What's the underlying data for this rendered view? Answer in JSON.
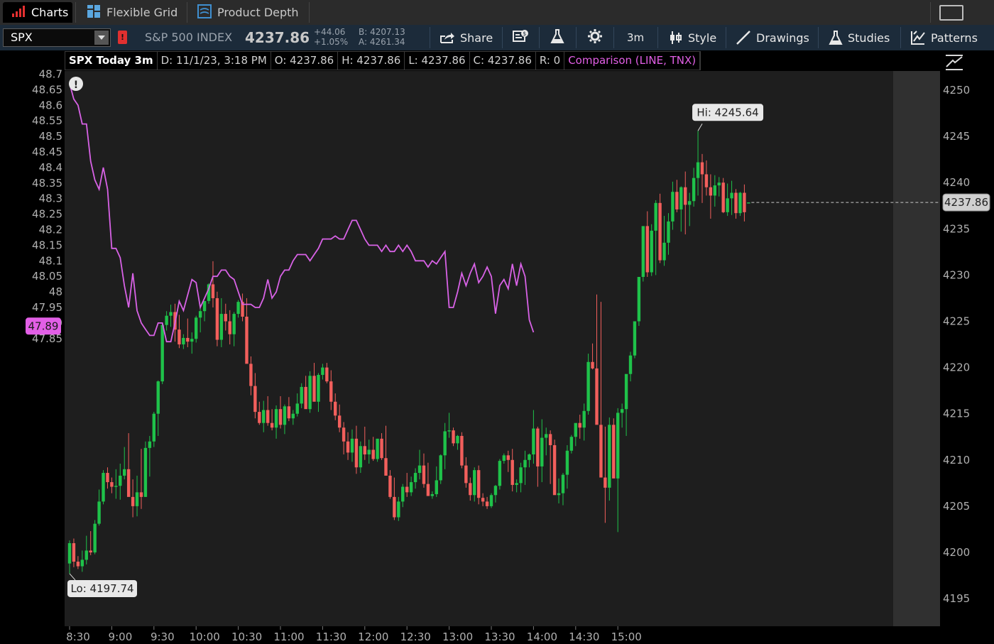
{
  "tabs": [
    {
      "label": "Charts",
      "icon": "bar-chart-icon",
      "active": true
    },
    {
      "label": "Flexible Grid",
      "icon": "grid-icon",
      "active": false
    },
    {
      "label": "Product Depth",
      "icon": "depth-icon",
      "active": false
    }
  ],
  "toolbar": {
    "symbol": "SPX",
    "alert_flag": "!",
    "index_name": "S&P 500 INDEX",
    "last_price": "4237.86",
    "net_change": "+44.06",
    "pct_change": "+1.05%",
    "bid": "B: 4207.13",
    "ask": "A: 4261.34",
    "share_label": "Share",
    "timeframe_label": "3m",
    "style_label": "Style",
    "drawings_label": "Drawings",
    "studies_label": "Studies",
    "patterns_label": "Patterns"
  },
  "infobar": {
    "title": "SPX Today 3m",
    "date": "D: 11/1/23, 3:18 PM",
    "open": "O: 4237.86",
    "high": "H: 4237.86",
    "low": "L: 4237.86",
    "close": "C: 4237.86",
    "range": "R: 0",
    "comparison": "Comparison (LINE, TNX)"
  },
  "colors": {
    "up": "#1fc24a",
    "down": "#f25f5c",
    "comparison": "#d862e6",
    "background": "#1e1e1e",
    "axis_text": "#b0b0b0"
  },
  "chart_data": {
    "type": "candlestick",
    "symbol": "SPX",
    "interval": "3m",
    "ylim_right": [
      4193,
      4253
    ],
    "ylim_left": [
      47.835,
      48.695
    ],
    "right_ticks": [
      "4250",
      "4245",
      "4240",
      "4235",
      "4230",
      "4225",
      "4220",
      "4215",
      "4210",
      "4205",
      "4200",
      "4195"
    ],
    "left_ticks": [
      "48.7",
      "48.65",
      "48.6",
      "48.55",
      "48.5",
      "48.45",
      "48.4",
      "48.35",
      "48.3",
      "48.25",
      "48.2",
      "48.15",
      "48.1",
      "48.05",
      "48",
      "47.95",
      "47.9",
      "47.85"
    ],
    "x_ticks": [
      "8:30",
      "9:00",
      "9:30",
      "10:00",
      "10:30",
      "11:00",
      "11:30",
      "12:00",
      "12:30",
      "13:00",
      "13:30",
      "14:00",
      "14:30",
      "15:00"
    ],
    "hi_label": "Hi: 4245.64",
    "lo_label": "Lo: 4197.74",
    "last_price_label": "4237.86",
    "comparison_last_label": "47.89",
    "candles": [
      [
        4198.8,
        4201.3,
        4197.7,
        4201.0
      ],
      [
        4201.0,
        4201.5,
        4198.4,
        4199.0
      ],
      [
        4199.0,
        4199.6,
        4198.2,
        4198.5
      ],
      [
        4198.5,
        4200.2,
        4197.9,
        4199.2
      ],
      [
        4199.2,
        4201.8,
        4198.7,
        4200.2
      ],
      [
        4200.2,
        4202.3,
        4199.7,
        4200.0
      ],
      [
        4200.0,
        4203.5,
        4199.8,
        4203.1
      ],
      [
        4203.1,
        4206.8,
        4202.9,
        4205.5
      ],
      [
        4205.5,
        4208.9,
        4205.2,
        4208.6
      ],
      [
        4208.6,
        4209.2,
        4206.9,
        4207.6
      ],
      [
        4207.6,
        4208.1,
        4206.4,
        4207.1
      ],
      [
        4207.1,
        4209.0,
        4205.8,
        4207.2
      ],
      [
        4207.2,
        4209.6,
        4205.7,
        4208.3
      ],
      [
        4208.3,
        4211.4,
        4207.9,
        4209.0
      ],
      [
        4209.0,
        4212.9,
        4208.4,
        4206.0
      ],
      [
        4206.0,
        4207.9,
        4203.8,
        4205.0
      ],
      [
        4205.0,
        4208.3,
        4203.9,
        4206.5
      ],
      [
        4206.5,
        4211.2,
        4204.7,
        4206.0
      ],
      [
        4206.0,
        4212.0,
        4206.0,
        4211.3
      ],
      [
        4211.3,
        4212.6,
        4208.2,
        4212.0
      ],
      [
        4212.0,
        4215.2,
        4211.4,
        4215.0
      ],
      [
        4215.0,
        4218.6,
        4212.6,
        4218.5
      ],
      [
        4218.5,
        4224.8,
        4218.2,
        4224.6
      ],
      [
        4224.6,
        4226.1,
        4224.0,
        4225.6
      ],
      [
        4225.6,
        4226.8,
        4224.4,
        4226.0
      ],
      [
        4226.0,
        4226.9,
        4222.8,
        4224.1
      ],
      [
        4224.1,
        4225.7,
        4222.1,
        4222.5
      ],
      [
        4222.5,
        4223.6,
        4222.0,
        4223.2
      ],
      [
        4223.2,
        4225.3,
        4222.2,
        4222.8
      ],
      [
        4222.8,
        4223.8,
        4221.5,
        4223.1
      ],
      [
        4223.1,
        4225.6,
        4222.7,
        4225.4
      ],
      [
        4225.4,
        4226.8,
        4223.8,
        4226.1
      ],
      [
        4226.1,
        4227.1,
        4225.0,
        4227.2
      ],
      [
        4227.2,
        4229.1,
        4226.9,
        4229.0
      ],
      [
        4229.0,
        4231.5,
        4226.5,
        4227.5
      ],
      [
        4227.5,
        4228.2,
        4222.3,
        4223.0
      ],
      [
        4223.0,
        4227.5,
        4222.2,
        4225.8
      ],
      [
        4225.8,
        4226.9,
        4224.0,
        4225.0
      ],
      [
        4225.0,
        4226.2,
        4222.5,
        4223.6
      ],
      [
        4223.6,
        4226.0,
        4222.3,
        4225.8
      ],
      [
        4225.8,
        4227.3,
        4225.4,
        4227.1
      ],
      [
        4227.1,
        4228.0,
        4225.0,
        4225.5
      ],
      [
        4225.5,
        4227.5,
        4223.7,
        4220.4
      ],
      [
        4220.4,
        4221.2,
        4217.0,
        4218.0
      ],
      [
        4218.0,
        4219.4,
        4214.5,
        4215.2
      ],
      [
        4215.2,
        4216.3,
        4213.8,
        4214.0
      ],
      [
        4214.0,
        4216.4,
        4213.0,
        4215.4
      ],
      [
        4215.4,
        4216.9,
        4213.7,
        4214.0
      ],
      [
        4214.0,
        4215.5,
        4213.2,
        4213.5
      ],
      [
        4213.5,
        4215.9,
        4212.3,
        4215.5
      ],
      [
        4215.5,
        4216.9,
        4213.4,
        4213.8
      ],
      [
        4213.8,
        4216.0,
        4212.8,
        4215.8
      ],
      [
        4215.8,
        4216.8,
        4214.2,
        4214.5
      ],
      [
        4214.5,
        4215.4,
        4213.8,
        4215.0
      ],
      [
        4215.0,
        4217.2,
        4214.7,
        4216.1
      ],
      [
        4216.1,
        4218.3,
        4215.6,
        4217.9
      ],
      [
        4217.9,
        4219.1,
        4217.3,
        4215.5
      ],
      [
        4215.5,
        4219.6,
        4215.1,
        4219.1
      ],
      [
        4219.1,
        4220.5,
        4218.1,
        4216.3
      ],
      [
        4216.3,
        4219.4,
        4215.2,
        4219.2
      ],
      [
        4219.2,
        4220.4,
        4218.7,
        4220.0
      ],
      [
        4220.0,
        4220.5,
        4218.3,
        4218.5
      ],
      [
        4218.5,
        4219.7,
        4215.4,
        4216.3
      ],
      [
        4216.3,
        4217.2,
        4214.3,
        4214.8
      ],
      [
        4214.8,
        4216.0,
        4213.0,
        4213.5
      ],
      [
        4213.5,
        4214.1,
        4210.6,
        4212.0
      ],
      [
        4212.0,
        4213.0,
        4210.0,
        4210.8
      ],
      [
        4210.8,
        4213.3,
        4209.8,
        4212.3
      ],
      [
        4212.3,
        4213.7,
        4208.5,
        4209.2
      ],
      [
        4209.2,
        4212.0,
        4208.6,
        4211.5
      ],
      [
        4211.5,
        4213.6,
        4210.0,
        4210.6
      ],
      [
        4210.6,
        4212.2,
        4209.6,
        4211.1
      ],
      [
        4211.1,
        4212.5,
        4209.9,
        4210.1
      ],
      [
        4210.1,
        4212.3,
        4209.8,
        4212.3
      ],
      [
        4212.3,
        4212.9,
        4210.0,
        4210.2
      ],
      [
        4210.2,
        4213.7,
        4209.6,
        4208.3
      ],
      [
        4208.3,
        4208.9,
        4205.8,
        4206.0
      ],
      [
        4206.0,
        4208.1,
        4203.5,
        4203.8
      ],
      [
        4203.8,
        4206.0,
        4203.4,
        4205.5
      ],
      [
        4205.5,
        4207.4,
        4204.9,
        4207.1
      ],
      [
        4207.1,
        4208.6,
        4206.0,
        4206.5
      ],
      [
        4206.5,
        4208.2,
        4206.1,
        4207.6
      ],
      [
        4207.6,
        4209.1,
        4206.9,
        4208.6
      ],
      [
        4208.6,
        4211.1,
        4207.9,
        4209.4
      ],
      [
        4209.4,
        4210.7,
        4207.0,
        4207.4
      ],
      [
        4207.4,
        4209.7,
        4206.3,
        4206.1
      ],
      [
        4206.1,
        4206.6,
        4205.8,
        4206.3
      ],
      [
        4206.3,
        4209.3,
        4206.0,
        4207.8
      ],
      [
        4207.8,
        4210.6,
        4207.4,
        4210.5
      ],
      [
        4210.5,
        4214.0,
        4209.0,
        4213.1
      ],
      [
        4213.1,
        4215.1,
        4212.4,
        4213.2
      ],
      [
        4213.2,
        4213.5,
        4211.5,
        4211.8
      ],
      [
        4211.8,
        4212.7,
        4211.1,
        4212.6
      ],
      [
        4212.6,
        4213.0,
        4209.1,
        4209.4
      ],
      [
        4209.4,
        4210.3,
        4207.0,
        4207.5
      ],
      [
        4207.5,
        4208.1,
        4205.6,
        4206.2
      ],
      [
        4206.2,
        4209.2,
        4205.5,
        4208.9
      ],
      [
        4208.9,
        4209.4,
        4205.2,
        4205.9
      ],
      [
        4205.9,
        4206.4,
        4205.0,
        4205.5
      ],
      [
        4205.5,
        4206.0,
        4204.7,
        4205.0
      ],
      [
        4205.0,
        4206.4,
        4204.8,
        4206.2
      ],
      [
        4206.2,
        4207.3,
        4205.4,
        4207.2
      ],
      [
        4207.2,
        4210.1,
        4206.8,
        4209.9
      ],
      [
        4209.9,
        4210.7,
        4209.6,
        4210.5
      ],
      [
        4210.5,
        4211.0,
        4208.7,
        4210.0
      ],
      [
        4210.0,
        4211.2,
        4206.6,
        4207.3
      ],
      [
        4207.3,
        4207.9,
        4206.5,
        4207.5
      ],
      [
        4207.5,
        4209.7,
        4206.5,
        4209.2
      ],
      [
        4209.2,
        4211.0,
        4207.3,
        4210.0
      ],
      [
        4210.0,
        4210.7,
        4209.2,
        4210.6
      ],
      [
        4210.6,
        4215.4,
        4209.6,
        4213.4
      ],
      [
        4213.4,
        4213.6,
        4207.1,
        4209.3
      ],
      [
        4209.3,
        4214.4,
        4207.6,
        4212.4
      ],
      [
        4212.4,
        4213.5,
        4210.5,
        4212.8
      ],
      [
        4212.8,
        4213.2,
        4207.4,
        4211.6
      ],
      [
        4211.6,
        4212.2,
        4206.6,
        4206.2
      ],
      [
        4206.2,
        4208.0,
        4205.3,
        4206.4
      ],
      [
        4206.4,
        4208.6,
        4205.1,
        4208.4
      ],
      [
        4208.4,
        4211.6,
        4206.9,
        4211.0
      ],
      [
        4211.0,
        4212.7,
        4210.7,
        4212.5
      ],
      [
        4212.5,
        4213.8,
        4211.5,
        4214.0
      ],
      [
        4214.0,
        4214.9,
        4212.3,
        4213.5
      ],
      [
        4213.5,
        4216.1,
        4212.1,
        4215.3
      ],
      [
        4215.3,
        4221.5,
        4214.9,
        4220.6
      ],
      [
        4220.6,
        4222.6,
        4219.8,
        4219.9
      ],
      [
        4219.9,
        4227.9,
        4217.9,
        4213.8
      ],
      [
        4213.8,
        4227.1,
        4209.1,
        4208.1
      ],
      [
        4208.1,
        4213.6,
        4203.2,
        4207.0
      ],
      [
        4207.0,
        4214.6,
        4205.6,
        4213.8
      ],
      [
        4213.8,
        4214.5,
        4210.2,
        4208.0
      ],
      [
        4208.0,
        4215.6,
        4202.2,
        4215.1
      ],
      [
        4215.1,
        4216.1,
        4213.5,
        4215.5
      ],
      [
        4215.5,
        4219.0,
        4212.6,
        4219.3
      ],
      [
        4219.3,
        4221.7,
        4218.5,
        4221.3
      ],
      [
        4221.3,
        4224.8,
        4221.0,
        4225.0
      ],
      [
        4225.0,
        4229.7,
        4224.5,
        4229.8
      ],
      [
        4229.8,
        4235.1,
        4229.3,
        4235.3
      ],
      [
        4235.3,
        4236.9,
        4229.8,
        4230.3
      ],
      [
        4230.3,
        4235.5,
        4229.9,
        4234.8
      ],
      [
        4234.8,
        4238.1,
        4230.0,
        4237.8
      ],
      [
        4237.8,
        4238.8,
        4231.3,
        4231.6
      ],
      [
        4231.6,
        4236.4,
        4231.0,
        4233.5
      ],
      [
        4233.5,
        4236.7,
        4232.2,
        4235.8
      ],
      [
        4235.8,
        4240.1,
        4234.9,
        4239.0
      ],
      [
        4239.0,
        4240.3,
        4236.8,
        4237.1
      ],
      [
        4237.1,
        4239.6,
        4234.7,
        4239.5
      ],
      [
        4239.5,
        4241.2,
        4234.4,
        4237.6
      ],
      [
        4237.6,
        4238.9,
        4235.3,
        4238.0
      ],
      [
        4238.0,
        4241.6,
        4237.4,
        4240.5
      ],
      [
        4240.5,
        4245.6,
        4238.6,
        4242.2
      ],
      [
        4242.2,
        4243.1,
        4237.8,
        4240.9
      ],
      [
        4240.9,
        4242.4,
        4238.6,
        4239.5
      ],
      [
        4239.5,
        4240.9,
        4236.1,
        4238.6
      ],
      [
        4238.6,
        4240.8,
        4237.4,
        4239.7
      ],
      [
        4239.7,
        4240.6,
        4238.5,
        4240.0
      ],
      [
        4240.0,
        4240.5,
        4236.7,
        4236.8
      ],
      [
        4236.8,
        4239.9,
        4236.4,
        4238.3
      ],
      [
        4238.3,
        4240.2,
        4236.5,
        4238.9
      ],
      [
        4238.9,
        4239.3,
        4236.1,
        4236.7
      ],
      [
        4236.7,
        4239.0,
        4236.4,
        4238.9
      ],
      [
        4238.9,
        4239.8,
        4235.8,
        4236.8
      ],
      [
        4237.86,
        4237.86,
        4237.86,
        4237.86
      ]
    ],
    "comparison_series": {
      "name": "TNX",
      "values": [
        48.67,
        48.62,
        48.6,
        48.54,
        48.54,
        48.42,
        48.36,
        48.33,
        48.4,
        48.33,
        48.14,
        48.14,
        48.11,
        48.02,
        47.95,
        48.06,
        47.94,
        47.9,
        47.88,
        47.86,
        47.86,
        47.9,
        47.9,
        47.84,
        47.84,
        47.9,
        47.97,
        47.94,
        47.99,
        48.04,
        48.03,
        47.95,
        47.98,
        48.01,
        48.05,
        48.05,
        48.07,
        48.07,
        48.05,
        48.04,
        48.0,
        47.96,
        47.96,
        47.96,
        47.95,
        47.95,
        47.98,
        48.04,
        47.98,
        48.0,
        48.05,
        48.07,
        48.07,
        48.1,
        48.12,
        48.12,
        48.12,
        48.1,
        48.12,
        48.14,
        48.17,
        48.17,
        48.17,
        48.18,
        48.17,
        48.17,
        48.2,
        48.23,
        48.23,
        48.2,
        48.17,
        48.15,
        48.15,
        48.15,
        48.13,
        48.15,
        48.13,
        48.13,
        48.15,
        48.13,
        48.15,
        48.13,
        48.1,
        48.1,
        48.1,
        48.08,
        48.1,
        48.09,
        48.11,
        48.13,
        47.95,
        47.95,
        48.0,
        48.06,
        48.02,
        48.06,
        48.09,
        48.03,
        48.05,
        48.08,
        48.05,
        47.93,
        48.02,
        48.04,
        48.01,
        48.09,
        48.02,
        48.09,
        48.05,
        47.91,
        47.87
      ]
    }
  },
  "side_panel": {
    "icon": "chart-settings-icon"
  }
}
